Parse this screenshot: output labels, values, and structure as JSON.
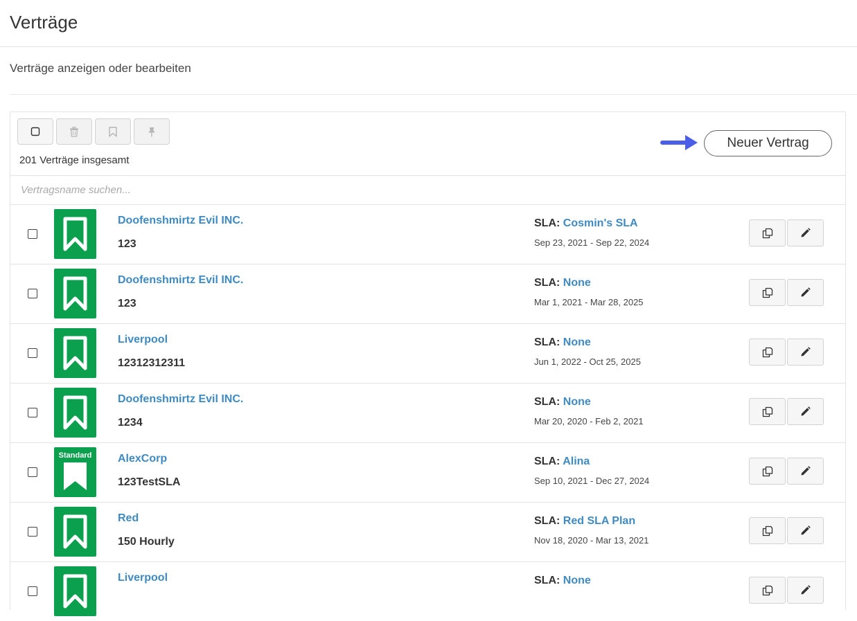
{
  "page": {
    "title": "Verträge",
    "subtitle": "Verträge anzeigen oder bearbeiten"
  },
  "toolbar": {
    "buttons": [
      "select-all",
      "delete",
      "bookmark",
      "pin"
    ],
    "total_text": "201 Verträge insgesamt",
    "new_button_label": "Neuer Vertrag"
  },
  "search": {
    "placeholder": "Vertragsname suchen..."
  },
  "sla_label": "SLA:",
  "contracts": [
    {
      "name": "Doofenshmirtz Evil INC.",
      "number": "123",
      "sla": "Cosmin's SLA",
      "dates": "Sep 23, 2021 - Sep 22, 2024",
      "tile_label": ""
    },
    {
      "name": "Doofenshmirtz Evil INC.",
      "number": "123",
      "sla": "None",
      "dates": "Mar 1, 2021 - Mar 28, 2025",
      "tile_label": ""
    },
    {
      "name": "Liverpool",
      "number": "12312312311",
      "sla": "None",
      "dates": "Jun 1, 2022 - Oct 25, 2025",
      "tile_label": ""
    },
    {
      "name": "Doofenshmirtz Evil INC.",
      "number": "1234",
      "sla": "None",
      "dates": "Mar 20, 2020 - Feb 2, 2021",
      "tile_label": ""
    },
    {
      "name": "AlexCorp",
      "number": "123TestSLA",
      "sla": "Alina",
      "dates": "Sep 10, 2021 - Dec 27, 2024",
      "tile_label": "Standard"
    },
    {
      "name": "Red",
      "number": "150 Hourly",
      "sla": "Red SLA Plan",
      "dates": "Nov 18, 2020 - Mar 13, 2021",
      "tile_label": ""
    },
    {
      "name": "Liverpool",
      "number": "",
      "sla": "None",
      "dates": "",
      "tile_label": ""
    }
  ],
  "colors": {
    "tile": "#0aa04d",
    "link": "#3f8ac0",
    "arrow": "#4a5ee8"
  }
}
